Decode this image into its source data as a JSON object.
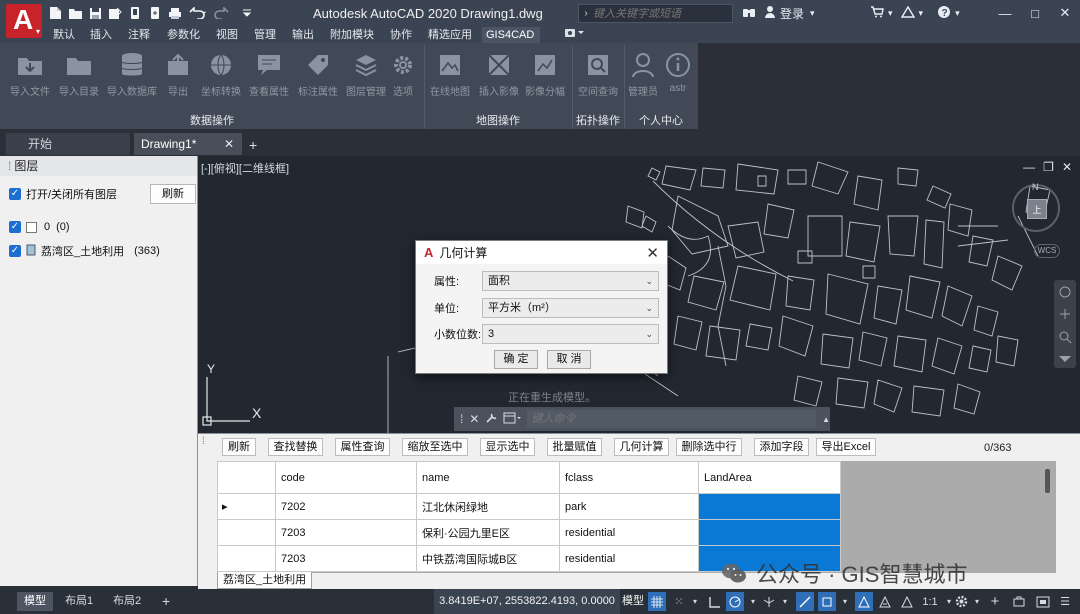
{
  "app": {
    "title": "Autodesk AutoCAD 2020    Drawing1.dwg",
    "search_placeholder": "键入关键字或短语",
    "login_label": "登录"
  },
  "ribbon": {
    "tabs": [
      "默认",
      "插入",
      "注释",
      "参数化",
      "视图",
      "管理",
      "输出",
      "附加模块",
      "协作",
      "精选应用",
      "GIS4CAD"
    ],
    "active_tab": "GIS4CAD",
    "buttons": [
      {
        "label": "导入文件",
        "icon": "folder-import-icon"
      },
      {
        "label": "导入目录",
        "icon": "folder-icon"
      },
      {
        "label": "导入数据库",
        "icon": "database-icon"
      },
      {
        "label": "导出",
        "icon": "export-icon"
      },
      {
        "label": "坐标转换",
        "icon": "globe-icon"
      },
      {
        "label": "查看属性",
        "icon": "properties-icon"
      },
      {
        "label": "标注属性",
        "icon": "label-icon"
      },
      {
        "label": "图层管理",
        "icon": "layers-icon"
      },
      {
        "label": "选项",
        "icon": "gear-icon"
      },
      {
        "label": "在线地图",
        "icon": "online-map-icon"
      },
      {
        "label": "插入影像",
        "icon": "insert-image-icon"
      },
      {
        "label": "影像分幅",
        "icon": "image-tile-icon"
      },
      {
        "label": "空间查询",
        "icon": "spatial-query-icon"
      },
      {
        "label": "管理员",
        "icon": "admin-icon"
      },
      {
        "label": "astr",
        "icon": "about-icon"
      }
    ],
    "groups": [
      "数据操作",
      "地图操作",
      "拓扑操作",
      "个人中心"
    ]
  },
  "file_tabs": {
    "start": "开始",
    "drawing": "Drawing1*"
  },
  "layer_panel": {
    "title": "图层",
    "toggle_all_label": "打开/关闭所有图层",
    "refresh_label": "刷新",
    "layers": [
      {
        "name": "0",
        "count": "(0)"
      },
      {
        "name": "荔湾区_土地利用",
        "count": "(363)"
      }
    ]
  },
  "viewport": {
    "view_label": "[-][俯视][二维线框]",
    "compass_letter": "N",
    "cube_label": "上",
    "wcs_label": "WCS",
    "ucs_y": "Y",
    "ucs_x": "X",
    "hint": "正在重生成模型。",
    "command_placeholder": "键入命令"
  },
  "dialog": {
    "title": "几何计算",
    "fields": [
      {
        "label": "属性:",
        "value": "面积"
      },
      {
        "label": "单位:",
        "value": "平方米（m²）"
      },
      {
        "label": "小数位数:",
        "value": "3"
      }
    ],
    "ok_label": "确 定",
    "cancel_label": "取 消"
  },
  "attribute_panel": {
    "buttons": [
      "刷新",
      "查找替换",
      "属性查询",
      "缩放至选中",
      "显示选中",
      "批量赋值",
      "几何计算",
      "删除选中行",
      "添加字段",
      "导出Excel"
    ],
    "count": "0/363",
    "columns": [
      "code",
      "name",
      "fclass",
      "LandArea"
    ],
    "rows": [
      {
        "marker": "▸",
        "code": "7202",
        "name": "江北休闲绿地",
        "fclass": "park",
        "LandArea": ""
      },
      {
        "marker": "",
        "code": "7203",
        "name": "保利·公园九里E区",
        "fclass": "residential",
        "LandArea": ""
      },
      {
        "marker": "",
        "code": "7203",
        "name": "中铁荔湾国际城B区",
        "fclass": "residential",
        "LandArea": ""
      }
    ],
    "sheet_tab": "荔湾区_土地利用"
  },
  "watermark": {
    "text": "公众号 · GIS智慧城市"
  },
  "status_bar": {
    "layout_tabs": [
      "模型",
      "布局1",
      "布局2"
    ],
    "coordinates": "3.8419E+07, 2553822.4193, 0.0000",
    "mode": "模型",
    "scale": "1:1"
  },
  "colors": {
    "title_bg": "#3b4453",
    "ribbon_bg": "#414956",
    "canvas_bg": "#212830",
    "selected_cell": "#0a79d6",
    "logo_red": "#c8222a"
  }
}
